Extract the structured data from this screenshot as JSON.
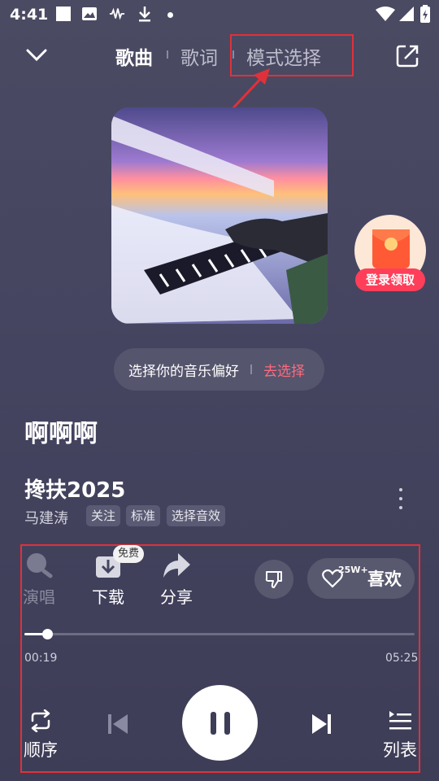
{
  "status": {
    "time": "4:41"
  },
  "header": {
    "tabs": [
      {
        "label": "歌曲"
      },
      {
        "label": "歌词"
      },
      {
        "label": "模式选择"
      }
    ]
  },
  "preference": {
    "text": "选择你的音乐偏好",
    "link": "去选择"
  },
  "login_badge": {
    "label": "登录领取"
  },
  "song": {
    "heading": "啊啊啊",
    "title": "搀扶2025",
    "artist": "马建涛",
    "tags": [
      {
        "label": "关注"
      },
      {
        "label": "标准"
      },
      {
        "label": "选择音效"
      }
    ]
  },
  "actions": {
    "sing": "演唱",
    "download": "下载",
    "free": "免费",
    "share": "分享",
    "like_count": "25W+",
    "like": "喜欢"
  },
  "progress": {
    "current": "00:19",
    "total": "05:25",
    "fraction": 0.058
  },
  "controls": {
    "mode": "顺序",
    "playlist": "列表"
  },
  "colors": {
    "annotation": "#e0313a",
    "accent": "#ff6b7d"
  }
}
